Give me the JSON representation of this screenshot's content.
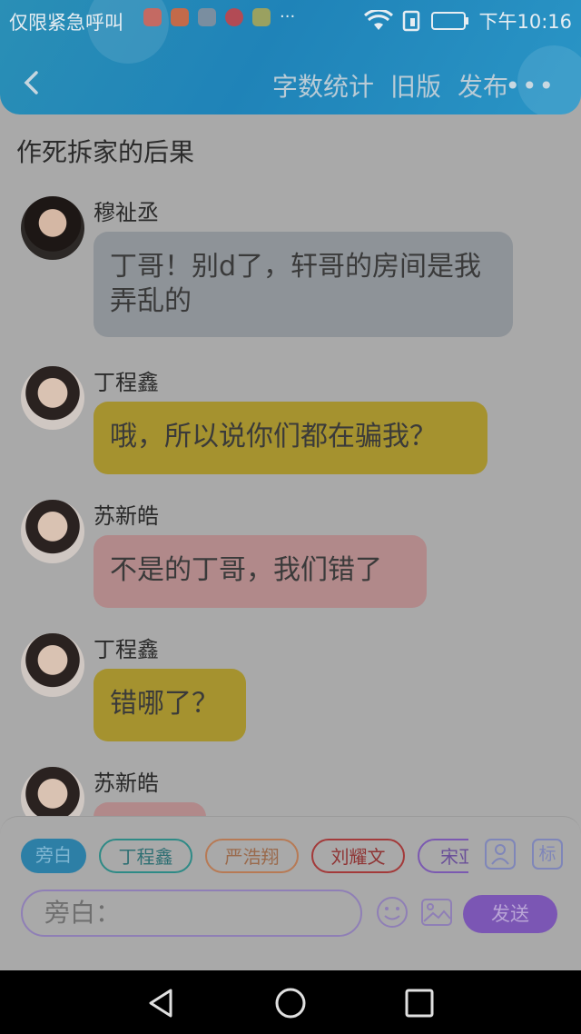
{
  "status_bar": {
    "carrier": "仅限紧急呼叫",
    "more": "···",
    "time": "下午10:16"
  },
  "nav": {
    "items": [
      "字数统计",
      "旧版",
      "发布"
    ],
    "more": "•••"
  },
  "story_title": "作死拆家的后果",
  "messages": [
    {
      "name": "穆祉丞",
      "text": "丁哥！别d了，轩哥的房间是我弄乱的",
      "bubble_color": "#8e9398"
    },
    {
      "name": "丁程鑫",
      "text": "哦，所以说你们都在骗我？",
      "bubble_color": "#a5922f"
    },
    {
      "name": "苏新皓",
      "text": "不是的丁哥，我们错了",
      "bubble_color": "#b1898a"
    },
    {
      "name": "丁程鑫",
      "text": "错哪了？",
      "bubble_color": "#a5922f"
    },
    {
      "name": "苏新皓",
      "text": "",
      "bubble_color": "#b1898a"
    }
  ],
  "role_chips": [
    "旁白",
    "丁程鑫",
    "严浩翔",
    "刘耀文",
    "宋亚"
  ],
  "chip_icons": {
    "person": "person-icon",
    "tag": "标"
  },
  "composer": {
    "placeholder": "旁白：",
    "send_label": "发送"
  },
  "colors": {
    "header": "#2289b9",
    "overlay": "#a9a9a9",
    "send": "#7b56b4"
  }
}
